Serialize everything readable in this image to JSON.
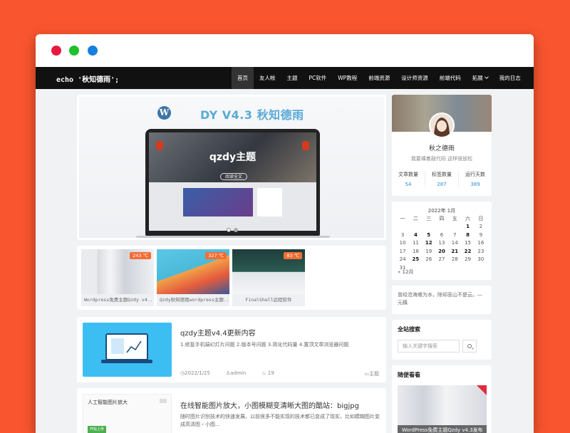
{
  "nav": {
    "brand": "echo '秋知德雨';",
    "items": [
      {
        "label": "首页",
        "active": true
      },
      {
        "label": "友人帐"
      },
      {
        "label": "主题"
      },
      {
        "label": "PC软件"
      },
      {
        "label": "WP教程"
      },
      {
        "label": "前端资源"
      },
      {
        "label": "设计师资源"
      },
      {
        "label": "前端代码"
      },
      {
        "label": "拓展",
        "has_dropdown": true
      },
      {
        "label": "我的日志"
      }
    ]
  },
  "banner": {
    "title": "DY V4.3 秋知德雨",
    "logo_letter": "W",
    "screen_title": "qzdy主题",
    "screen_button": "阅读全文",
    "slides": 2,
    "active_slide": 1
  },
  "thumbs": [
    {
      "caption": "Wordpress免费主题Qzdy v4...",
      "temp": "243 ℃"
    },
    {
      "caption": "Qzdy秋知德雨wordpress主题...",
      "temp": "327 ℃"
    },
    {
      "caption": "FinalShell远程软件",
      "temp": "83 ℃"
    }
  ],
  "posts": [
    {
      "title": "qzdy主题v4.4更新内容",
      "excerpt": "1.修复手机端幻灯片问题 2.版本号问题 3.简化代码量 4.置顶文章浏览器问题",
      "date": "2022/1/25",
      "author": "admin",
      "views": "19",
      "category": "主题"
    },
    {
      "title": "在线智能图片放大，小图模糊变清晰大图的酷站：bigjpg",
      "excerpt": "随时图片识别技术的快速发展，以前很多不能实现的技术都已变成了现实，比如模糊图片变成高清图・小图...",
      "thumb_label": "人工智能图片放大",
      "thumb_button": "开始上传"
    }
  ],
  "profile": {
    "name": "秋之德雨",
    "desc": "我要裸着敲代码 这样很放松",
    "stats": [
      {
        "label": "文章数量",
        "value": "54"
      },
      {
        "label": "标签数量",
        "value": "287"
      },
      {
        "label": "运行天数",
        "value": "389"
      }
    ]
  },
  "calendar": {
    "caption": "2022年 1月",
    "weekdays": [
      "一",
      "二",
      "三",
      "四",
      "五",
      "六",
      "日"
    ],
    "rows": [
      [
        "",
        "",
        "",
        "",
        "",
        "1",
        "2"
      ],
      [
        "3",
        "4",
        "5",
        "6",
        "7",
        "8",
        "9"
      ],
      [
        "10",
        "11",
        "12",
        "13",
        "14",
        "15",
        "16"
      ],
      [
        "17",
        "18",
        "19",
        "20",
        "21",
        "22",
        "23"
      ],
      [
        "24",
        "25",
        "26",
        "27",
        "28",
        "29",
        "30"
      ],
      [
        "31",
        "",
        "",
        "",
        "",
        "",
        ""
      ]
    ],
    "bold_days": [
      "1",
      "4",
      "5",
      "8",
      "12",
      "20",
      "21",
      "22",
      "25"
    ],
    "prev": "« 12月"
  },
  "quote": "曾经沧海难为水，除却巫山不是云。—元稹",
  "search": {
    "title": "全站搜索",
    "placeholder": "输入关键字搜索"
  },
  "random": {
    "title": "随便看看",
    "caption": "WordPress免费主题Qzdy v4.3发布"
  },
  "colors": {
    "background": "#f9552e",
    "nav": "#111111",
    "accent": "#2f8fd8",
    "tag": "#f36d34"
  }
}
